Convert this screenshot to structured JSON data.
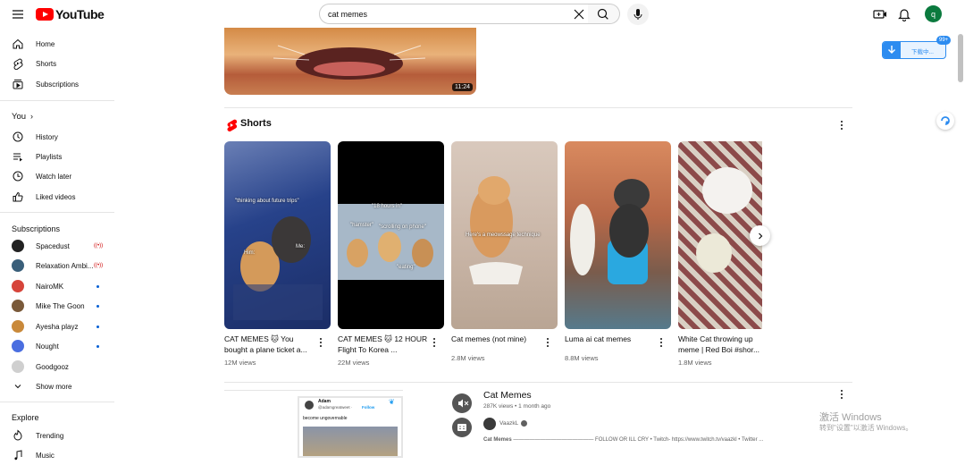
{
  "header": {
    "logo_text": "YouTube",
    "search_value": "cat memes",
    "avatar_letter": "q"
  },
  "sidebar": {
    "main": [
      {
        "label": "Home",
        "icon": "home-icon"
      },
      {
        "label": "Shorts",
        "icon": "shorts-icon"
      },
      {
        "label": "Subscriptions",
        "icon": "subscriptions-icon"
      }
    ],
    "you_heading": "You",
    "you": [
      {
        "label": "History",
        "icon": "history-icon"
      },
      {
        "label": "Playlists",
        "icon": "playlists-icon"
      },
      {
        "label": "Watch later",
        "icon": "watch-later-icon"
      },
      {
        "label": "Liked videos",
        "icon": "like-icon"
      }
    ],
    "subscriptions_heading": "Subscriptions",
    "subscriptions": [
      {
        "label": "Spacedust",
        "status": "live",
        "avatar_color": "#222222"
      },
      {
        "label": "Relaxation Ambi...",
        "status": "live",
        "avatar_color": "#3a5f7a"
      },
      {
        "label": "NairoMK",
        "status": "new",
        "avatar_color": "#d6443a"
      },
      {
        "label": "Mike The Goon",
        "status": "new",
        "avatar_color": "#7a5a3a"
      },
      {
        "label": "Ayesha playz",
        "status": "new",
        "avatar_color": "#c9893a"
      },
      {
        "label": "Nought",
        "status": "new",
        "avatar_color": "#4a6ee0"
      },
      {
        "label": "Goodgooz",
        "status": "",
        "avatar_color": "#cfcfcf"
      }
    ],
    "show_more": "Show more",
    "explore_heading": "Explore",
    "explore": [
      {
        "label": "Trending",
        "icon": "trending-icon"
      },
      {
        "label": "Music",
        "icon": "music-icon"
      }
    ]
  },
  "top_video": {
    "duration": "11:24"
  },
  "shorts": {
    "heading": "Shorts",
    "items": [
      {
        "title": "CAT MEMES 🐱 You bought a plane ticket a...",
        "views": "12M views",
        "captions": [
          "\"thinking about future trips\"",
          "Me:",
          "Him:"
        ]
      },
      {
        "title": "CAT MEMES 🐱 12 HOUR Flight To Korea ...",
        "views": "22M views",
        "captions": [
          "\"18 hours in\"",
          "\"hamster\"",
          "\"scrolling on phone\"",
          "\"eating\""
        ]
      },
      {
        "title": "Cat memes (not mine)",
        "views": "2.8M views",
        "captions": [
          "Here's a meowssage technique"
        ]
      },
      {
        "title": "Luma ai cat memes",
        "views": "8.8M views",
        "captions": []
      },
      {
        "title": "White Cat throwing up meme | Red Boi #shor...",
        "views": "1.8M views",
        "captions": []
      }
    ]
  },
  "video_result": {
    "title": "Cat Memes",
    "meta": "287K views • 1 month ago",
    "channel": "VaazkL",
    "description_bold": "Cat Memes",
    "description": "——————————————— FOLLOW OR ILL CRY • Twitch- https://www.twitch.tv/vaazkl • Twitter ...",
    "thumb_tweet_name": "Adam",
    "thumb_tweet_handle": "@adamgreatweet ·",
    "thumb_tweet_follow": "Follow",
    "thumb_tweet_text": "become ungovernable"
  },
  "extension": {
    "download_label": "下载中...",
    "badge": "99+"
  },
  "watermark": {
    "line1": "激活 Windows",
    "line2": "转到\"设置\"以激活 Windows。"
  }
}
